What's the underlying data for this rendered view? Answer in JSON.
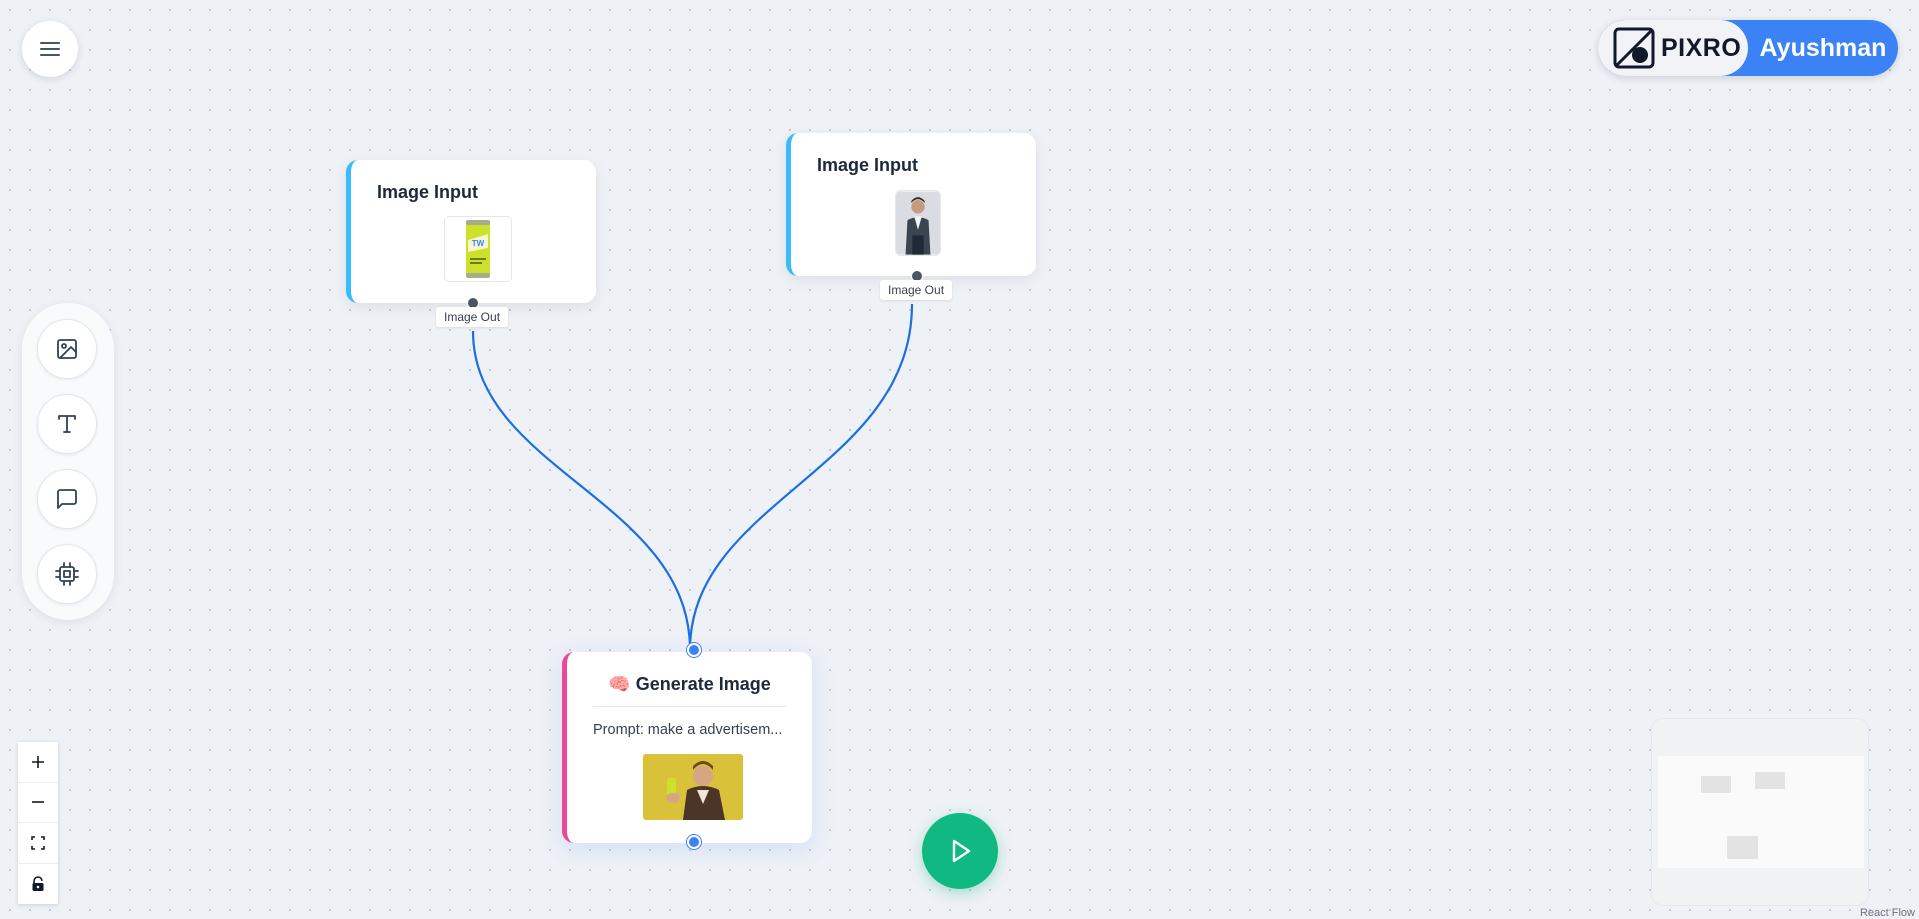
{
  "menu": {
    "icon": "hamburger-menu-icon"
  },
  "brand": {
    "logo_text": "PIXRO",
    "logo_icon": "pixro-logo-icon",
    "user_name": "Ayushman"
  },
  "palette": {
    "tools": [
      {
        "name": "image-tool",
        "icon": "image-icon"
      },
      {
        "name": "text-tool",
        "icon": "text-icon"
      },
      {
        "name": "comment-tool",
        "icon": "message-square-icon"
      },
      {
        "name": "processor-tool",
        "icon": "cpu-icon"
      }
    ]
  },
  "nodes": {
    "image_input_1": {
      "title": "Image Input",
      "output_label": "Image Out",
      "thumbnail": "yellow soda can"
    },
    "image_input_2": {
      "title": "Image Input",
      "output_label": "Image Out",
      "thumbnail": "man in denim jacket"
    },
    "generate": {
      "emoji": "🧠",
      "title": "Generate Image",
      "prompt": "Prompt: make a advertisem...",
      "thumbnail": "man holding soda can"
    }
  },
  "controls": {
    "zoom_in": "+",
    "zoom_out": "—",
    "fit_view_icon": "fit-view-icon",
    "lock_icon": "lock-icon"
  },
  "run_button": {
    "icon": "play-icon"
  },
  "attribution": "React Flow",
  "colors": {
    "accent": "#3b82f6",
    "input_node_border": "#38bdf8",
    "generate_node_border": "#ec4899",
    "run": "#10b981",
    "edge": "#1d6fe0"
  }
}
